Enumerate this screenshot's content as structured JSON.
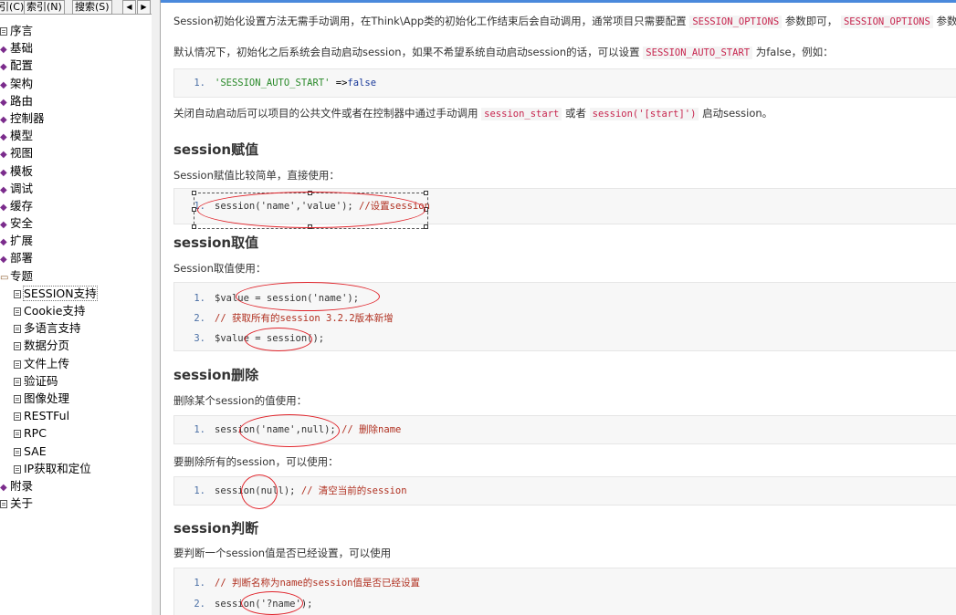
{
  "left": {
    "tabs": [
      "引(C)",
      "索引(N)",
      "搜索(S)"
    ],
    "arrows": [
      "◀",
      "▶"
    ],
    "tree": [
      {
        "label": "序言",
        "icon": "page-icon",
        "level": 1
      },
      {
        "label": "基础",
        "icon": "diamond-icon",
        "level": 1
      },
      {
        "label": "配置",
        "icon": "diamond-icon",
        "level": 1
      },
      {
        "label": "架构",
        "icon": "diamond-icon",
        "level": 1
      },
      {
        "label": "路由",
        "icon": "diamond-icon",
        "level": 1
      },
      {
        "label": "控制器",
        "icon": "diamond-icon",
        "level": 1
      },
      {
        "label": "模型",
        "icon": "diamond-icon",
        "level": 1
      },
      {
        "label": "视图",
        "icon": "diamond-icon",
        "level": 1
      },
      {
        "label": "模板",
        "icon": "diamond-icon",
        "level": 1
      },
      {
        "label": "调试",
        "icon": "diamond-icon",
        "level": 1
      },
      {
        "label": "缓存",
        "icon": "diamond-icon",
        "level": 1
      },
      {
        "label": "安全",
        "icon": "diamond-icon",
        "level": 1
      },
      {
        "label": "扩展",
        "icon": "diamond-icon",
        "level": 1
      },
      {
        "label": "部署",
        "icon": "diamond-icon",
        "level": 1
      },
      {
        "label": "专题",
        "icon": "open-book-icon",
        "level": 1
      },
      {
        "label": "SESSION支持",
        "icon": "page-icon",
        "level": 2
      },
      {
        "label": "Cookie支持",
        "icon": "page-icon",
        "level": 2
      },
      {
        "label": "多语言支持",
        "icon": "page-icon",
        "level": 2
      },
      {
        "label": "数据分页",
        "icon": "page-icon",
        "level": 2
      },
      {
        "label": "文件上传",
        "icon": "page-icon",
        "level": 2
      },
      {
        "label": "验证码",
        "icon": "page-icon",
        "level": 2
      },
      {
        "label": "图像处理",
        "icon": "page-icon",
        "level": 2
      },
      {
        "label": "RESTFul",
        "icon": "page-icon",
        "level": 2
      },
      {
        "label": "RPC",
        "icon": "page-icon",
        "level": 2
      },
      {
        "label": "SAE",
        "icon": "page-icon",
        "level": 2
      },
      {
        "label": "IP获取和定位",
        "icon": "page-icon",
        "level": 2
      },
      {
        "label": "附录",
        "icon": "diamond-icon",
        "level": 1
      },
      {
        "label": "关于",
        "icon": "page-icon",
        "level": 1
      }
    ]
  },
  "content": {
    "p1a": "Session初始化设置方法无需手动调用，在Think\\App类的初始化工作结束后会自动调用，通常项目只需要配置",
    "p1_code1": "SESSION_OPTIONS",
    "p1b": "参数即可，",
    "p1_code2": "SESSION_OPTIONS",
    "p1c": "参数的设置是",
    "p2a": "默认情况下，初始化之后系统会自动启动session，如果不希望系统自动启动session的话，可以设置",
    "p2_code": "SESSION_AUTO_START",
    "p2b": "为false，例如：",
    "code1": {
      "n": "1.",
      "str": "'SESSION_AUTO_START'",
      "op": " =>",
      "kw": "false"
    },
    "p3a": "关闭自动启动后可以项目的公共文件或者在控制器中通过手动调用",
    "p3_code1": "session_start",
    "p3b": "或者",
    "p3_code2": "session('[start]')",
    "p3c": "启动session。",
    "h1": "session赋值",
    "p4": "Session赋值比较简单，直接使用：",
    "code2": {
      "n": "1.",
      "text": "session('name','value');",
      "com": "  //设置session"
    },
    "h2": "session取值",
    "p5": "Session取值使用：",
    "code3": [
      {
        "n": "1.",
        "text": "$value = session('name');",
        "com": ""
      },
      {
        "n": "2.",
        "text": "",
        "com": "// 获取所有的session 3.2.2版本新增"
      },
      {
        "n": "3.",
        "text": "$value = session();",
        "com": ""
      }
    ],
    "h3": "session删除",
    "p6": "删除某个session的值使用：",
    "code4": {
      "n": "1.",
      "text": "session('name',null);",
      "com": " // 删除name"
    },
    "p7": "要删除所有的session，可以使用：",
    "code5": {
      "n": "1.",
      "text": "session(null);",
      "com": " // 清空当前的session"
    },
    "h4": "session判断",
    "p8": "要判断一个session值是否已经设置，可以使用",
    "code6": [
      {
        "n": "1.",
        "text": "",
        "com": "// 判断名称为name的session值是否已经设置"
      },
      {
        "n": "2.",
        "text": "session('?name');",
        "com": ""
      }
    ]
  },
  "colors": {
    "accent": "#4a89dc",
    "annotation": "#e0232a",
    "inline_code": "#c7254e"
  }
}
